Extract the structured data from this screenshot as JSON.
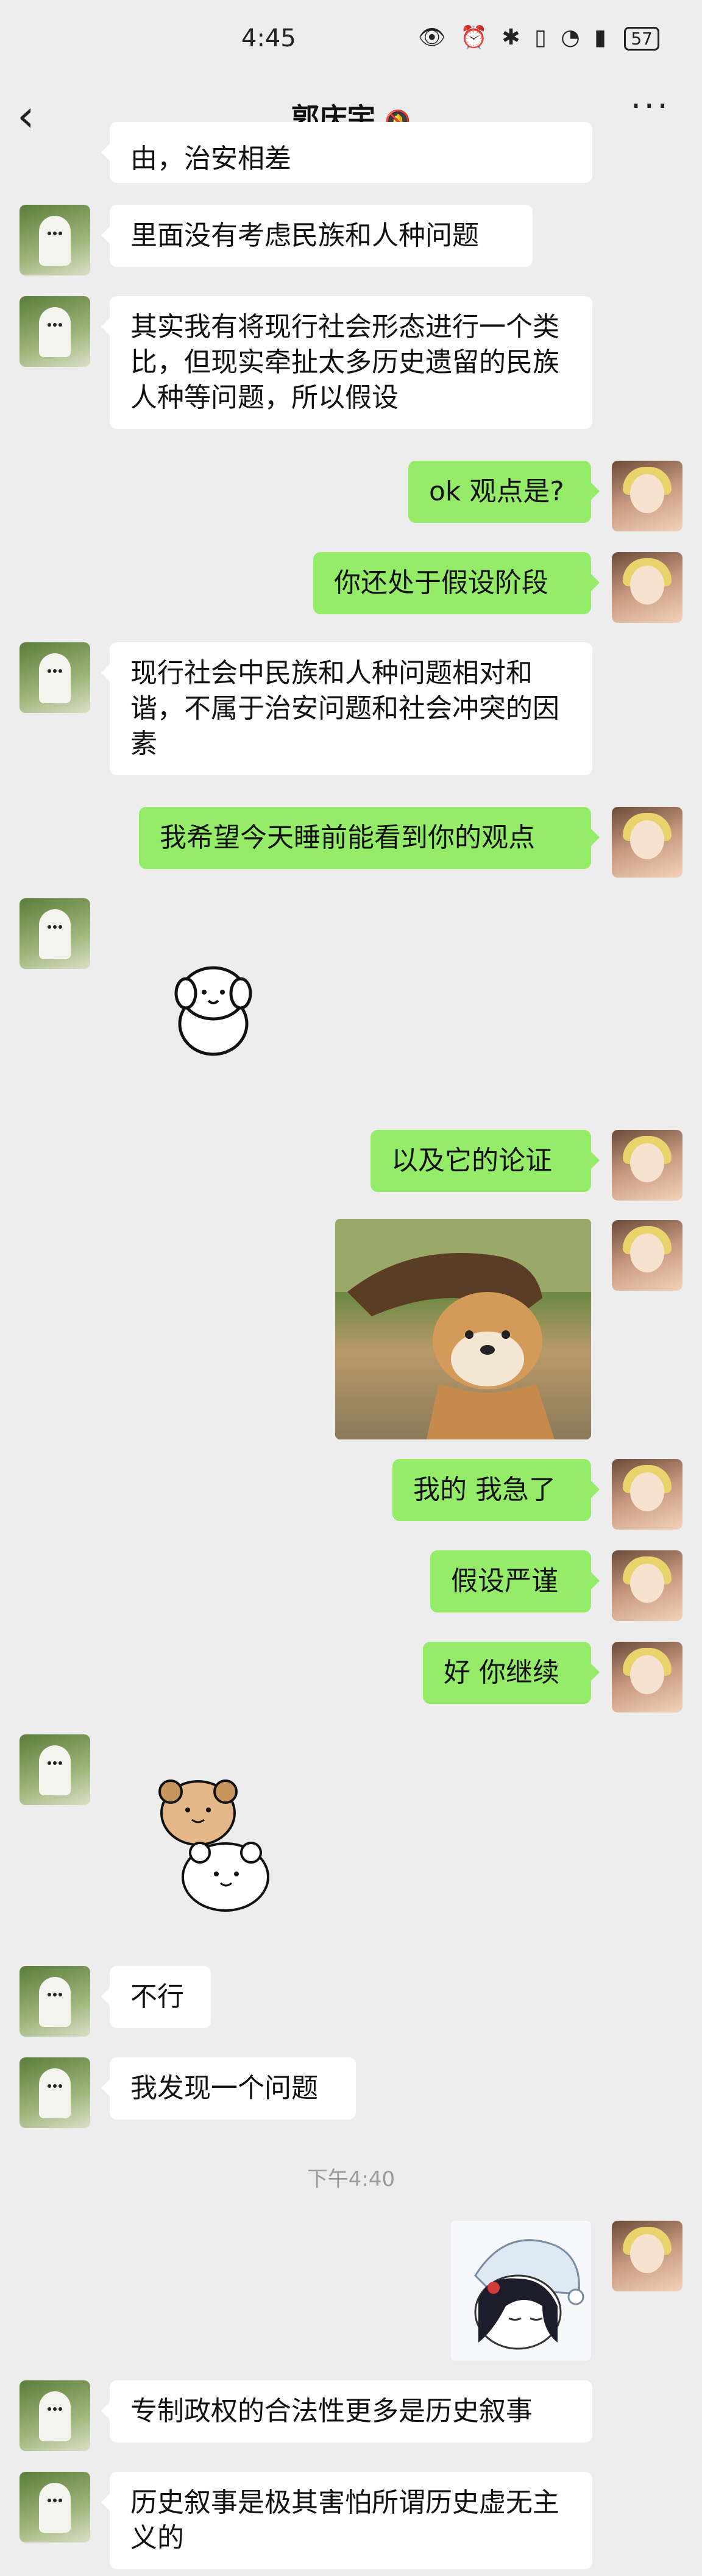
{
  "status": {
    "time": "4:45",
    "battery": "57",
    "icons": "👁 ⏰ ✱ ▯ ◔ ▮"
  },
  "header": {
    "title": "郭庆宇",
    "mute_icon": "bell-off-icon",
    "more_icon": "more-icon",
    "back_icon": "back-chevron-icon"
  },
  "messages": [
    {
      "side": "left",
      "text": "由，治安相差"
    },
    {
      "side": "left",
      "text": "里面没有考虑民族和人种问题"
    },
    {
      "side": "left",
      "text": "其实我有将现行社会形态进行一个类比，但现实牵扯太多历史遗留的民族人种等问题，所以假设"
    },
    {
      "side": "right",
      "text": "ok 观点是?"
    },
    {
      "side": "right",
      "text": "你还处于假设阶段"
    },
    {
      "side": "left",
      "text": "现行社会中民族和人种问题相对和谐，不属于治安问题和社会冲突的因素"
    },
    {
      "side": "right",
      "text": "我希望今天睡前能看到你的观点"
    },
    {
      "side": "left",
      "type": "sticker",
      "sticker": "white-puppy-sticker"
    },
    {
      "side": "right",
      "text": "以及它的论证"
    },
    {
      "side": "right",
      "type": "image",
      "image": "shiba-dog-wind-hair-image"
    },
    {
      "side": "right",
      "text": "我的 我急了"
    },
    {
      "side": "right",
      "text": "假设严谨"
    },
    {
      "side": "right",
      "text": "好 你继续"
    },
    {
      "side": "left",
      "type": "sticker",
      "sticker": "two-bears-sticker"
    },
    {
      "side": "left",
      "text": "不行"
    },
    {
      "side": "left",
      "text": "我发现一个问题"
    },
    {
      "type": "timestamp",
      "text": "下午4:40"
    },
    {
      "side": "right",
      "type": "image",
      "image": "anime-girl-nightcap-sticker"
    },
    {
      "side": "left",
      "text": "专制政权的合法性更多是历史叙事"
    },
    {
      "side": "left",
      "text": "历史叙事是极其害怕所谓历史虚无主义的"
    }
  ]
}
